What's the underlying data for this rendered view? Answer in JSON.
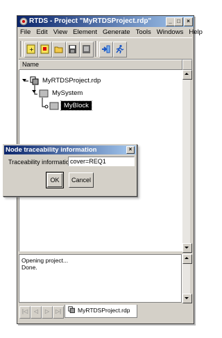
{
  "window": {
    "title": "RTDS - Project \"MyRTDSProject.rdp\"",
    "minimize": "_",
    "maximize": "□",
    "close": "×"
  },
  "menu": [
    "File",
    "Edit",
    "View",
    "Element",
    "Generate",
    "Tools",
    "Windows",
    "Help"
  ],
  "toolbar_icons": [
    "new-project-icon",
    "new-element-icon",
    "open-folder-icon",
    "save-icon",
    "save-all-icon",
    "import-icon",
    "run-icon"
  ],
  "tree": {
    "column_header": "Name",
    "nodes": [
      {
        "label": "MyRTDSProject.rdp",
        "icon": "project-icon"
      },
      {
        "label": "MySystem",
        "icon": "system-icon"
      },
      {
        "label": "MyBlock",
        "icon": "block-icon",
        "selected": true
      }
    ]
  },
  "console": {
    "lines": [
      "Opening project...",
      "Done."
    ]
  },
  "tabs": {
    "nav": [
      "|◁",
      "◁",
      "▷",
      "▷|"
    ],
    "active": "MyRTDSProject.rdp"
  },
  "dialog": {
    "title": "Node traceability information",
    "close": "×",
    "field_label": "Traceability information:",
    "field_value": "cover=REQ1",
    "ok_label": "OK",
    "cancel_label": "Cancel"
  },
  "colors": {
    "title_start": "#0a246a",
    "title_end": "#a6caf0",
    "face": "#d4d0c8",
    "selection": "#000000"
  }
}
